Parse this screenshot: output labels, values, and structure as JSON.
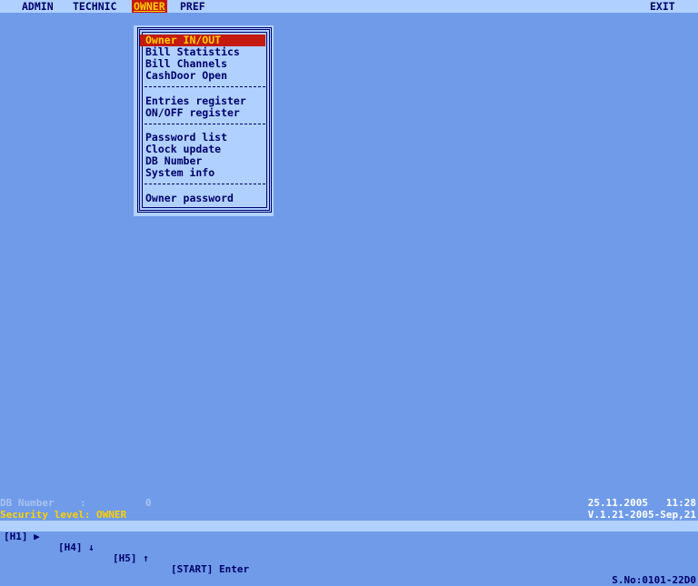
{
  "menubar": {
    "items": [
      {
        "label": "ADMIN"
      },
      {
        "label": "TECHNIC"
      },
      {
        "label": "OWNER"
      },
      {
        "label": "PREF"
      }
    ],
    "exit_label": "EXIT"
  },
  "owner_menu": {
    "items": [
      "Owner IN/OUT",
      "Bill Statistics",
      "Bill Channels",
      "CashDoor Open",
      "Entries register",
      "ON/OFF register",
      "Password list",
      "Clock update",
      "DB Number",
      "System info",
      "Owner password"
    ],
    "separator": "-----------------"
  },
  "status": {
    "db_label": "DB Number",
    "db_colon": ":",
    "db_value": "0",
    "security_prefix": "Security level:",
    "security_value": "OWNER",
    "date": "25.11.2005",
    "time": "11:28",
    "version": "V.1.21-2005-Sep,21",
    "serial": "S.No:0101-22D0"
  },
  "keybar": {
    "h1": "[H1]",
    "h1_arrow": "▶",
    "h4": "[H4]",
    "h4_arrow": "↓",
    "h5": "[H5]",
    "h5_arrow": "↑",
    "start": "[START]",
    "enter": "Enter"
  },
  "colors": {
    "background": "#6f9be9",
    "bar": "#b0d0ff",
    "text": "#00006a",
    "highlight_bg": "#c41a10",
    "highlight_fg": "#ffd000"
  }
}
